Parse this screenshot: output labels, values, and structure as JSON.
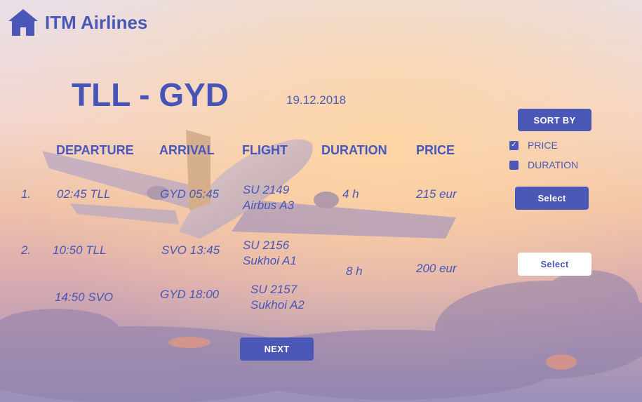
{
  "header": {
    "brand_name": "ITM Airlines",
    "home_icon": "house-icon"
  },
  "route": {
    "title": "TLL - GYD",
    "date": "19.12.2018"
  },
  "table": {
    "headers": [
      "DEPARTURE",
      "ARRIVAL",
      "FLIGHT",
      "DURATION",
      "PRICE"
    ],
    "options": [
      {
        "number": "1.",
        "legs": [
          {
            "departure": "02:45 TLL",
            "arrival": "GYD 05:45",
            "flight": "SU 2149",
            "aircraft": "Airbus A3"
          }
        ],
        "duration": "4 h",
        "price": "215 eur",
        "select_label": "Select"
      },
      {
        "number": "2.",
        "legs": [
          {
            "departure": "10:50 TLL",
            "arrival": "SVO 13:45",
            "flight": "SU 2156",
            "aircraft": "Sukhoi A1"
          },
          {
            "departure": "14:50 SVO",
            "arrival": "GYD 18:00",
            "flight": "SU 2157",
            "aircraft": "Sukhoi A2"
          }
        ],
        "duration": "8 h",
        "price": "200 eur",
        "select_label": "Select"
      }
    ]
  },
  "sort": {
    "label": "SORT BY",
    "options": [
      {
        "label": "PRICE",
        "checked": true
      },
      {
        "label": "DURATION",
        "checked": false
      }
    ]
  },
  "footer": {
    "next_label": "NEXT"
  },
  "colors": {
    "accent": "#4b58b5",
    "text": "#4756bb",
    "white": "#ffffff"
  }
}
